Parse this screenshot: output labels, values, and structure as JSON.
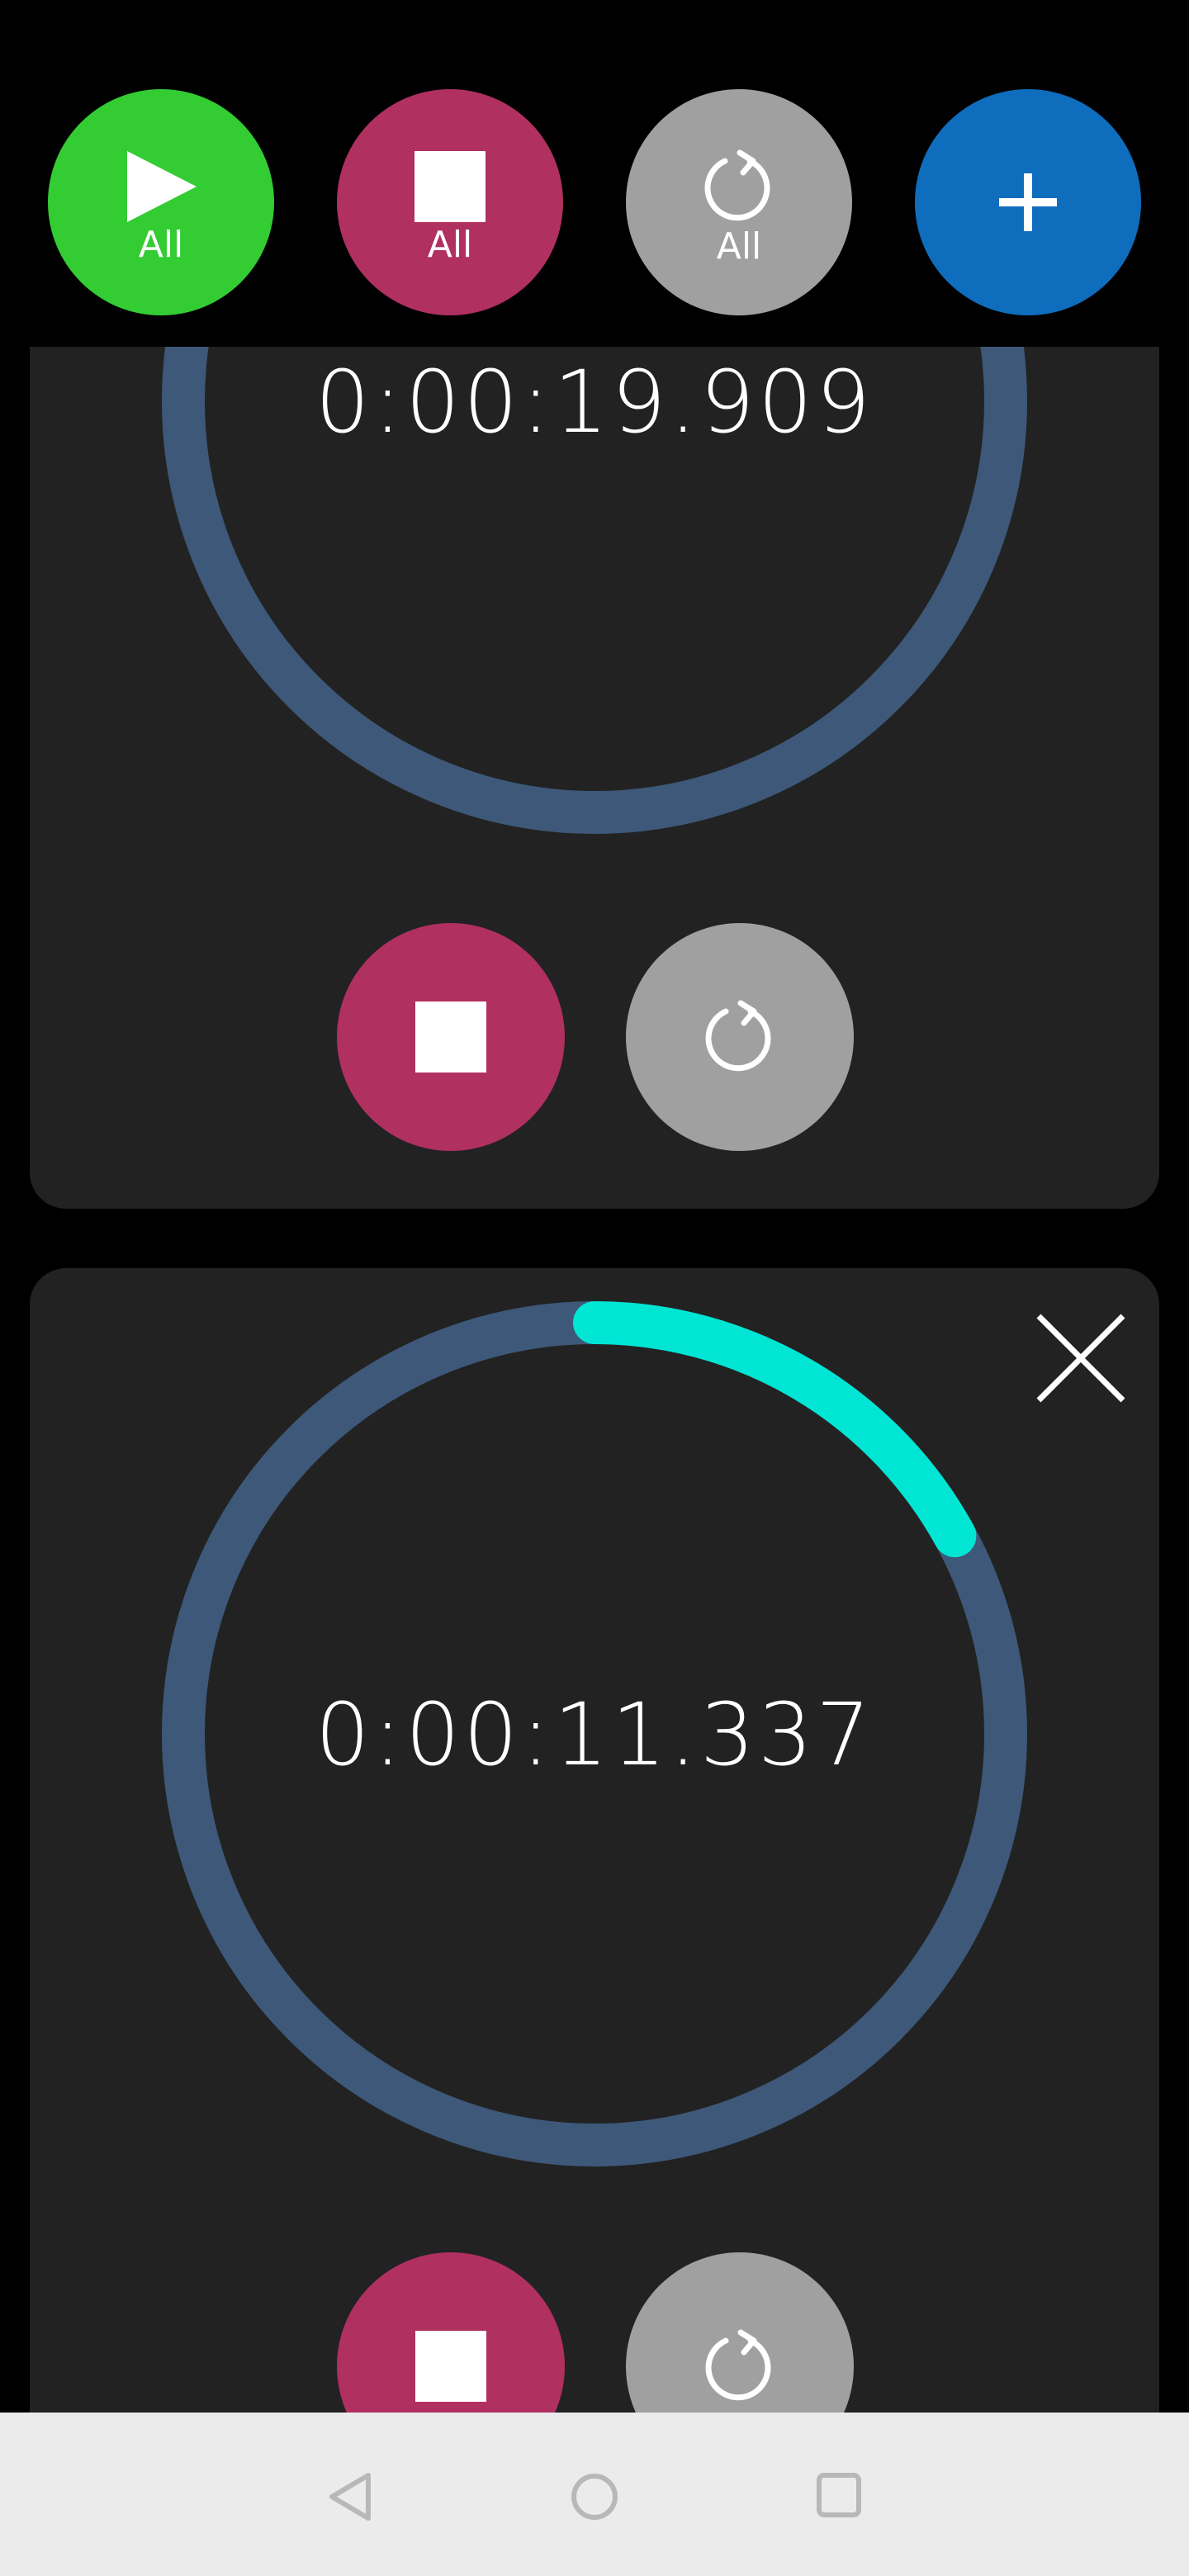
{
  "toolbar": {
    "start_all": {
      "label": "All",
      "color": "#33cc33",
      "icon": "play-icon"
    },
    "stop_all": {
      "label": "All",
      "color": "#b03060",
      "icon": "stop-icon"
    },
    "reset_all": {
      "label": "All",
      "color": "#a0a0a0",
      "icon": "reset-icon"
    },
    "add": {
      "color": "#0f6dbd",
      "icon": "plus-icon"
    }
  },
  "timers": [
    {
      "time": "0:00:19.909",
      "progress_fraction": 0.085,
      "arc_color": "#00e5b0",
      "track_color": "#3d5878",
      "stop_icon": "stop-icon",
      "reset_icon": "reset-icon"
    },
    {
      "time": "0:00:11.337",
      "progress_fraction": 0.17,
      "arc_color": "#00e5d4",
      "track_color": "#3d5878",
      "stop_icon": "stop-icon",
      "reset_icon": "reset-icon",
      "close_icon": "close-icon"
    }
  ],
  "navigation": {
    "back_icon": "back-triangle-icon",
    "home_icon": "home-circle-icon",
    "recents_icon": "recents-square-icon"
  }
}
